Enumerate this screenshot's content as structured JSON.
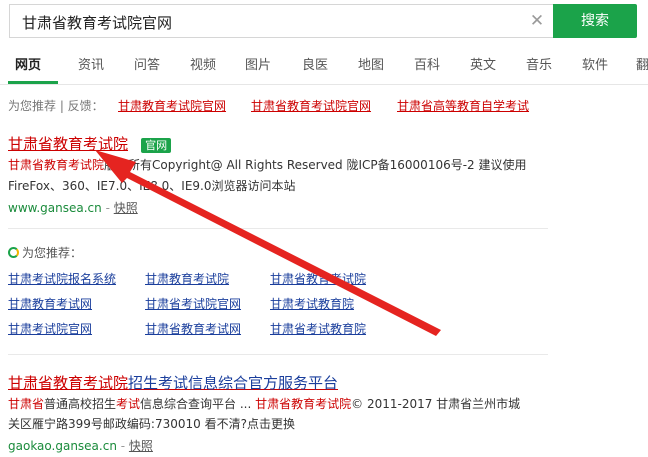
{
  "search": {
    "query": "甘肃省教育考试院官网",
    "button_label": "搜索",
    "clear_icon": "close-icon"
  },
  "tabs": [
    {
      "label": "网页",
      "active": true
    },
    {
      "label": "资讯"
    },
    {
      "label": "问答"
    },
    {
      "label": "视频"
    },
    {
      "label": "图片"
    },
    {
      "label": "良医"
    },
    {
      "label": "地图"
    },
    {
      "label": "百科"
    },
    {
      "label": "英文"
    },
    {
      "label": "音乐"
    },
    {
      "label": "软件"
    },
    {
      "label": "翻"
    }
  ],
  "recommend_bar": {
    "prefix": "为您推荐 | 反馈：",
    "links": [
      "甘肃教育考试院官网",
      "甘肃省教育考试院官网",
      "甘肃省高等教育自学考试"
    ]
  },
  "result1": {
    "title": "甘肃省教育考试院",
    "badge": "官网",
    "desc_hl": "甘肃省教育考试院",
    "desc_line1_rest": "版权所有Copyright@ All Rights Reserved 陇ICP备16000106号-2 建议使用",
    "desc_line2": "FireFox、360、IE7.0、IE8.0、IE9.0浏览器访问本站",
    "url": "www.gansea.cn",
    "snapshot": "快照"
  },
  "recommend_block": {
    "heading": "为您推荐：",
    "links": [
      [
        "甘肃考试院报名系统",
        "甘肃教育考试院",
        "甘肃省教育考试院"
      ],
      [
        "甘肃教育考试网",
        "甘肃省考试院官网",
        "甘肃考试教育院"
      ],
      [
        "甘肃考试院官网",
        "甘肃省教育考试网",
        "甘肃省考试教育院"
      ]
    ]
  },
  "result2": {
    "title_hl": "甘肃省教育考试院",
    "title_rest": "招生考试信息综合官方服务平台",
    "desc_line1": [
      {
        "t": "甘肃省",
        "hl": true
      },
      {
        "t": "普通高校招生"
      },
      {
        "t": "考试",
        "hl": true
      },
      {
        "t": "信息综合查询平台 ... "
      },
      {
        "t": "甘肃省教育考试院",
        "hl": true
      },
      {
        "t": "© 2011-2017 甘肃省兰州市城"
      }
    ],
    "desc_line2": "关区雁宁路399号邮政编码:730010 看不清?点击更换",
    "url": "gaokao.gansea.cn",
    "snapshot": "快照"
  },
  "colors": {
    "accent_green": "#1ba34a",
    "highlight_red": "#cc0000",
    "arrow_red": "#e52420",
    "link_blue": "#1a3e9c"
  }
}
